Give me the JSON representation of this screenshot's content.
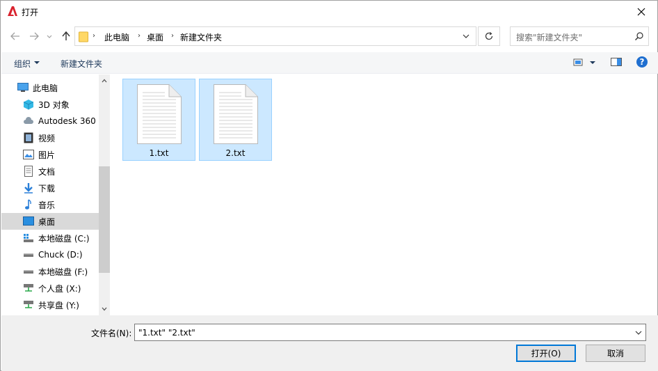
{
  "window": {
    "title": "打开",
    "app_icon": "autocad-logo-icon"
  },
  "address": {
    "crumbs": [
      "此电脑",
      "桌面",
      "新建文件夹"
    ],
    "search_placeholder": "搜索\"新建文件夹\""
  },
  "toolbar": {
    "organize_label": "组织",
    "new_folder_label": "新建文件夹"
  },
  "nav_pane": {
    "items": [
      {
        "label": "此电脑",
        "icon": "computer-icon",
        "level": 0,
        "selected": false
      },
      {
        "label": "3D 对象",
        "icon": "3d-objects-icon",
        "level": 1,
        "selected": false
      },
      {
        "label": "Autodesk 360",
        "icon": "cloud-icon",
        "level": 1,
        "selected": false
      },
      {
        "label": "视频",
        "icon": "video-icon",
        "level": 1,
        "selected": false
      },
      {
        "label": "图片",
        "icon": "pictures-icon",
        "level": 1,
        "selected": false
      },
      {
        "label": "文档",
        "icon": "documents-icon",
        "level": 1,
        "selected": false
      },
      {
        "label": "下载",
        "icon": "download-icon",
        "level": 1,
        "selected": false
      },
      {
        "label": "音乐",
        "icon": "music-icon",
        "level": 1,
        "selected": false
      },
      {
        "label": "桌面",
        "icon": "desktop-icon",
        "level": 1,
        "selected": true
      },
      {
        "label": "本地磁盘 (C:)",
        "icon": "system-drive-icon",
        "level": 1,
        "selected": false
      },
      {
        "label": "Chuck (D:)",
        "icon": "drive-icon",
        "level": 1,
        "selected": false
      },
      {
        "label": "本地磁盘 (F:)",
        "icon": "drive-icon",
        "level": 1,
        "selected": false
      },
      {
        "label": "个人盘 (X:)",
        "icon": "network-drive-icon",
        "level": 1,
        "selected": false
      },
      {
        "label": "共享盘 (Y:)",
        "icon": "network-drive-icon",
        "level": 1,
        "selected": false
      }
    ]
  },
  "files": [
    {
      "name": "1.txt",
      "icon": "text-document-icon",
      "selected": true
    },
    {
      "name": "2.txt",
      "icon": "text-document-icon",
      "selected": true
    }
  ],
  "bottom": {
    "filename_label": "文件名(N):",
    "filename_value": "\"1.txt\" \"2.txt\"",
    "open_label": "打开(O)",
    "cancel_label": "取消"
  },
  "colors": {
    "selection_bg": "#cce8ff",
    "selection_border": "#99d1ff",
    "accent": "#0078d7",
    "app_red": "#d9232e"
  }
}
